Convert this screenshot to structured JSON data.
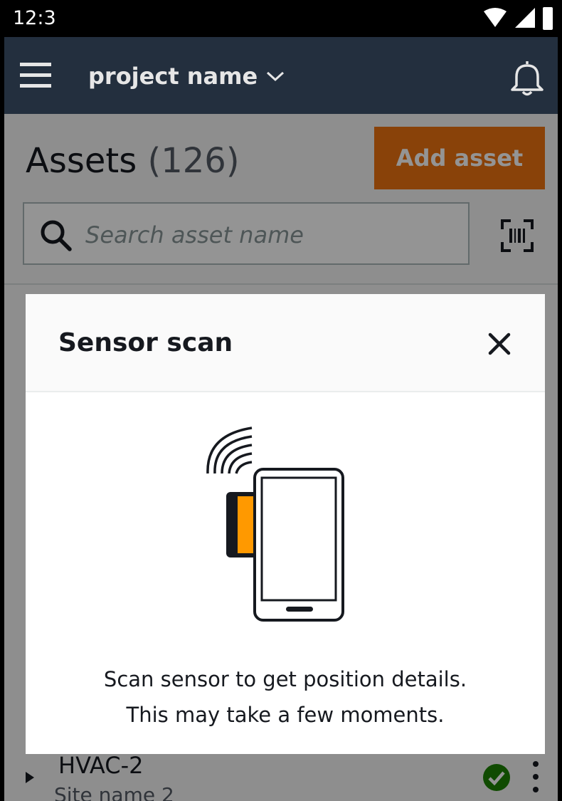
{
  "status_bar": {
    "time": "12:3"
  },
  "app_bar": {
    "project_name": "project name"
  },
  "assets": {
    "title": "Assets",
    "count": "(126)",
    "add_label": "Add asset",
    "search_placeholder": "Search asset name"
  },
  "asset_list": [
    {
      "name": "HVAC-2",
      "site": "Site name 2"
    }
  ],
  "modal": {
    "title": "Sensor scan",
    "message_line1": "Scan sensor to get position details.",
    "message_line2": "This may take a few moments."
  },
  "colors": {
    "app_bar": "#232f3e",
    "accent": "#ec7211",
    "status_ok": "#1d8102",
    "text": "#16191f"
  },
  "icons": [
    "menu-icon",
    "chevron-down-icon",
    "bell-icon",
    "search-icon",
    "barcode-scan-icon",
    "close-icon",
    "sensor-scan-illustration",
    "status-ok-icon",
    "more-vert-icon"
  ]
}
